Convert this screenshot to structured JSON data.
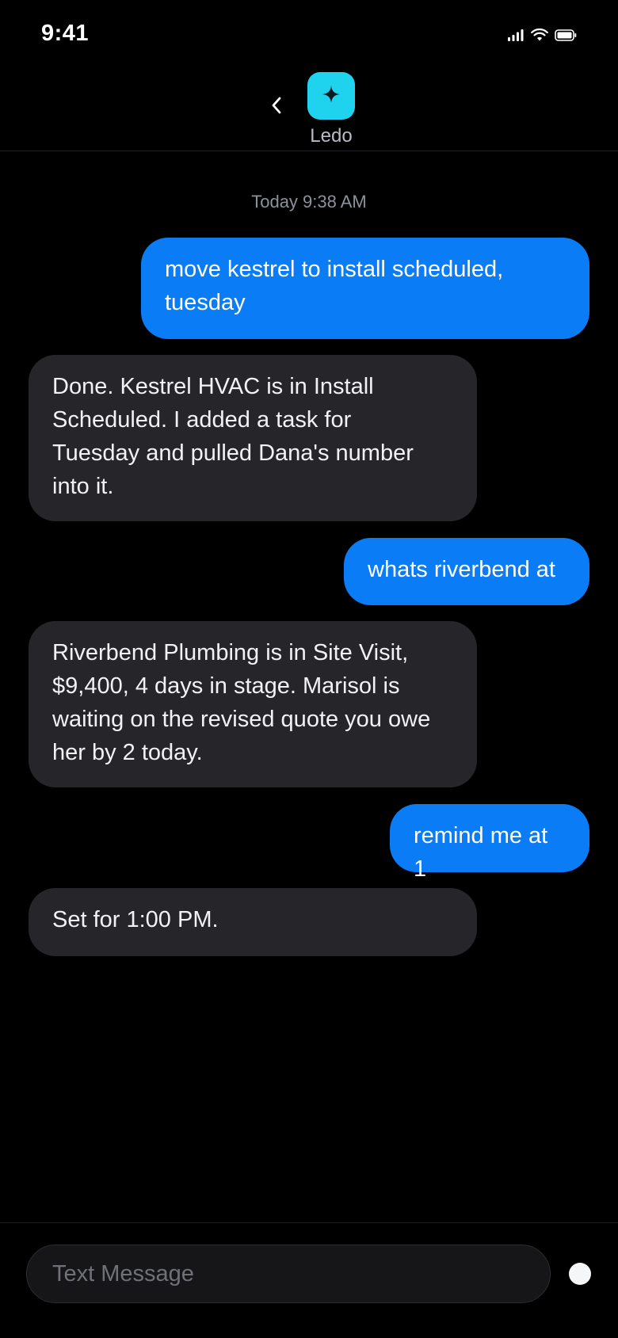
{
  "status_bar": {
    "time": "9:41"
  },
  "header": {
    "contact_name": "Ledo",
    "avatar_icon": "sparkle-icon",
    "avatar_color": "#1fd3ee"
  },
  "conversation": {
    "timestamp": "Today 9:38 AM",
    "messages": [
      {
        "direction": "outgoing",
        "text": "move kestrel to install scheduled,\ntuesday"
      },
      {
        "direction": "incoming",
        "text": "Done. Kestrel HVAC is in Install\nScheduled. I added a task for\nTuesday and pulled Dana's number\ninto it."
      },
      {
        "direction": "outgoing",
        "text": "whats riverbend at"
      },
      {
        "direction": "incoming",
        "text": "Riverbend Plumbing is in Site Visit,\n$9,400, 4 days in stage. Marisol is\nwaiting on the revised quote you owe\nher by 2 today."
      },
      {
        "direction": "outgoing",
        "text": "remind me at 1"
      },
      {
        "direction": "incoming",
        "text": "Set for 1:00 PM."
      }
    ]
  },
  "composer": {
    "placeholder": "Text Message"
  },
  "colors": {
    "outgoing_bubble": "#0a7cf5",
    "incoming_bubble": "#26262a",
    "background": "#000000"
  }
}
